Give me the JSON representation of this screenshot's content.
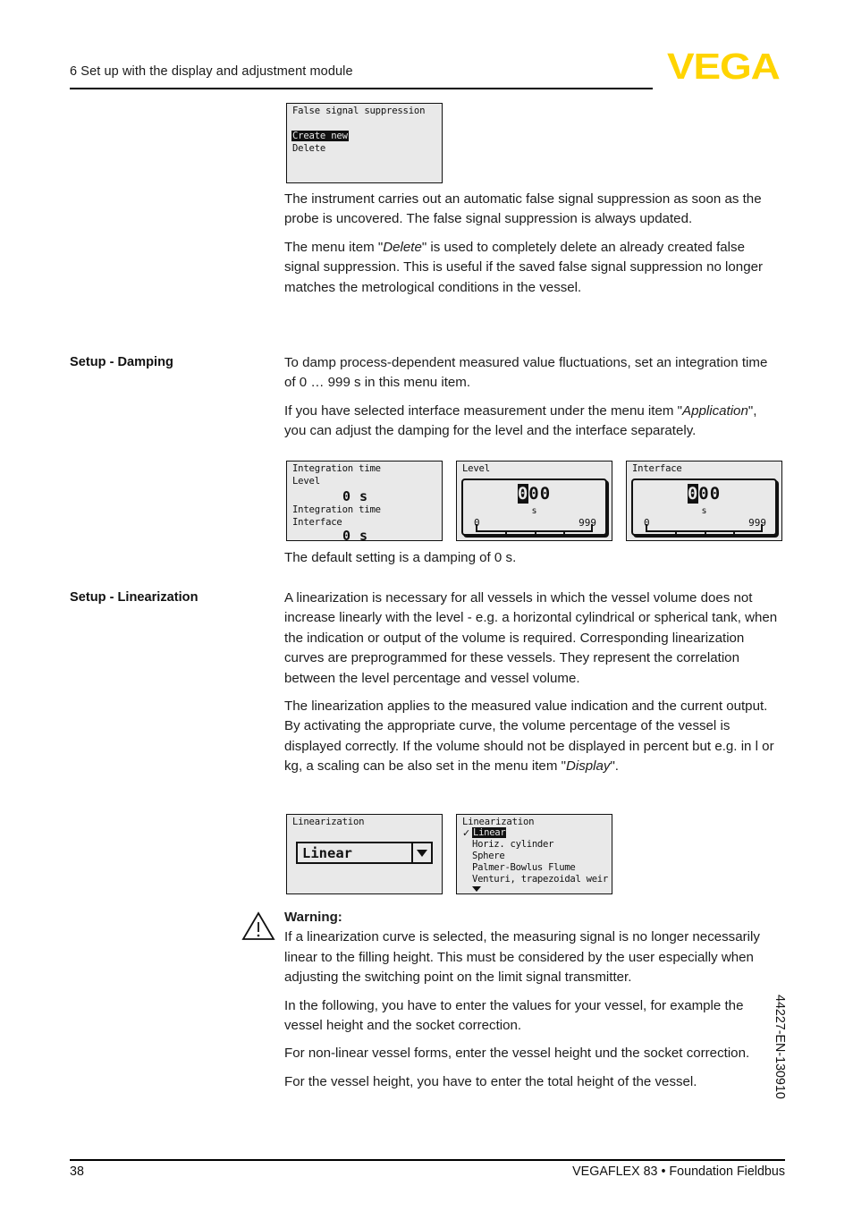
{
  "header": {
    "chapter_title": "6 Set up with the display and adjustment module",
    "logo": "VEGA"
  },
  "displays": {
    "false_signal_suppression": {
      "title": "False signal suppression",
      "items": [
        "Create new",
        "Delete"
      ],
      "selected": "Create new"
    },
    "integration_time": {
      "line1": "Integration time",
      "line2": "Level",
      "value1": "0 s",
      "line3": "Integration time",
      "line4": "Interface",
      "value2": "0 s"
    },
    "level_damping": {
      "title": "Level",
      "value": "000",
      "selected_digit": "0",
      "rest_digits": "00",
      "unit": "s",
      "scale_min": "0",
      "scale_max": "999"
    },
    "interface_damping": {
      "title": "Interface",
      "value": "000",
      "selected_digit": "0",
      "rest_digits": "00",
      "unit": "s",
      "scale_min": "0",
      "scale_max": "999"
    },
    "linearization_select": {
      "title": "Linearization",
      "selected": "Linear"
    },
    "linearization_list": {
      "title": "Linearization",
      "items": [
        "Linear",
        "Horiz. cylinder",
        "Sphere",
        "Palmer-Bowlus Flume",
        "Venturi, trapezoidal weir"
      ],
      "checked": "Linear",
      "more_indicator": "down-arrow"
    }
  },
  "sections": {
    "false_signal": {
      "para1": "The instrument carries out an automatic false signal suppression as soon as the probe is uncovered. The false signal suppression is always updated.",
      "para2_a": "The menu item \"",
      "para2_i": "Delete",
      "para2_b": "\" is used to completely delete an already created false signal suppression. This is useful if the saved false signal suppression no longer matches the metrological conditions in the vessel."
    },
    "damping": {
      "label": "Setup - Damping",
      "para1": "To damp process-dependent measured value fluctuations, set an integration time of 0 … 999 s in this menu item.",
      "para2_a": "If you have selected interface measurement under the menu item \"",
      "para2_i": "Application",
      "para2_b": "\", you can adjust the damping for the level and the interface separately.",
      "para3": "The default setting is a damping of 0 s."
    },
    "linearization": {
      "label": "Setup - Linearization",
      "para1": "A linearization is necessary for all vessels in which the vessel volume does not increase linearly with the level - e.g. a horizontal cylindrical or spherical tank, when the indication or output of the volume is required. Corresponding linearization curves are preprogrammed for these vessels. They represent the correlation between the level percentage and vessel volume.",
      "para2_a": "The linearization applies to the measured value indication and the current output. By activating the appropriate curve, the volume percentage of the vessel is displayed correctly. If the volume should not be displayed in percent but e.g. in l or kg, a scaling can be also set in the menu item \"",
      "para2_i": "Display",
      "para2_b": "\"."
    },
    "warning": {
      "title": "Warning:",
      "body": "If a linearization curve is selected, the measuring signal is no longer necessarily linear to the filling height. This must be considered by the user especially when adjusting the switching point on the limit signal transmitter.",
      "para2": "In the following, you have to enter the values for your vessel, for example the vessel height and the socket correction.",
      "para3": "For non-linear vessel forms, enter the vessel height und the socket correction.",
      "para4": "For the vessel height, you have to enter the total height of the vessel."
    }
  },
  "footer": {
    "page_number": "38",
    "document_line": "VEGAFLEX 83 • Foundation Fieldbus",
    "side_code": "44227-EN-130910"
  }
}
